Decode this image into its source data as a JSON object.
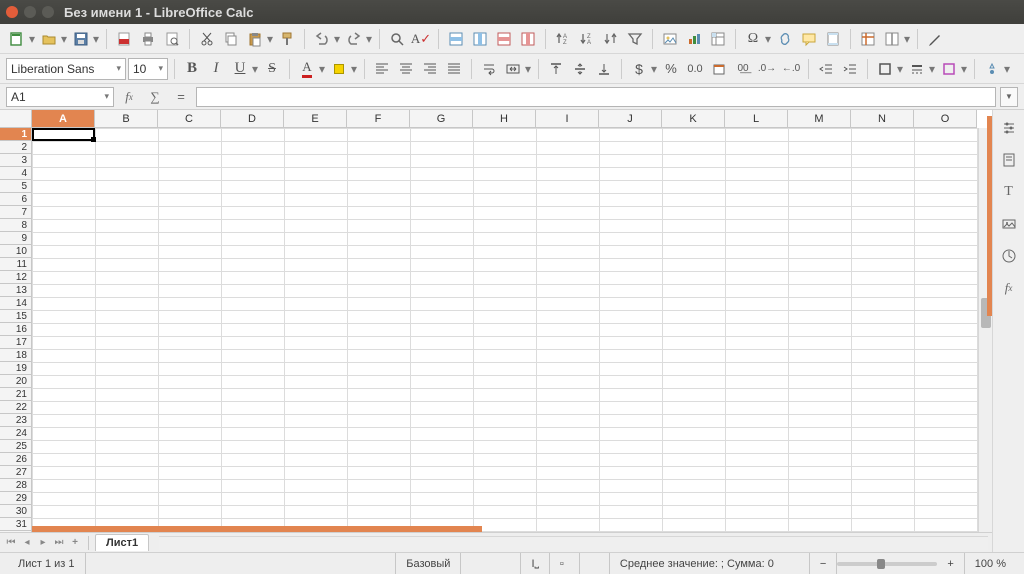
{
  "title": "Без имени 1 - LibreOffice Calc",
  "font": {
    "name": "Liberation Sans",
    "size": "10"
  },
  "namebox": "A1",
  "formula": "",
  "columns": [
    "A",
    "B",
    "C",
    "D",
    "E",
    "F",
    "G",
    "H",
    "I",
    "J",
    "K",
    "L",
    "M",
    "N",
    "O"
  ],
  "rows": [
    "1",
    "2",
    "3",
    "4",
    "5",
    "6",
    "7",
    "8",
    "9",
    "10",
    "11",
    "12",
    "13",
    "14",
    "15",
    "16",
    "17",
    "18",
    "19",
    "20",
    "21",
    "22",
    "23",
    "24",
    "25",
    "26",
    "27",
    "28",
    "29",
    "30",
    "31"
  ],
  "selected_col": "A",
  "selected_row": "1",
  "tabs": {
    "sheet1": "Лист1"
  },
  "status": {
    "sheet_pos": "Лист 1 из 1",
    "style": "Базовый",
    "summary": "Среднее значение: ; Сумма: 0",
    "zoom": "100 %"
  },
  "tooltips": {
    "new": "New",
    "open": "Open",
    "save": "Save",
    "pdf": "Export PDF",
    "print": "Print",
    "preview": "Print Preview",
    "cut": "Cut",
    "copy": "Copy",
    "paste": "Paste",
    "clone": "Clone Formatting",
    "undo": "Undo",
    "redo": "Redo",
    "find": "Find & Replace",
    "spell": "Spelling",
    "row": "Row",
    "column": "Column",
    "sort_asc": "Sort Ascending",
    "sort_desc": "Sort Descending",
    "autofilter": "AutoFilter",
    "chart": "Chart",
    "pivot": "Pivot Table",
    "image": "Image",
    "special": "Special Character",
    "hyperlink": "Hyperlink",
    "comment": "Comment",
    "headers": "Headers & Footers",
    "freeze": "Freeze",
    "split": "Split Window",
    "bold": "Bold",
    "italic": "Italic",
    "underline": "Underline",
    "strike": "Strikethrough",
    "fontcolor": "Font Color",
    "highlight": "Highlighting",
    "al": "Align Left",
    "ac": "Align Center",
    "ar": "Align Right",
    "aj": "Justified",
    "wrap": "Wrap Text",
    "merge": "Merge Cells",
    "at": "Align Top",
    "am": "Align Middle",
    "ab": "Align Bottom",
    "curr": "Currency",
    "pct": "Percent",
    "num": "Number",
    "date": "Date",
    "std": "Standard",
    "add_dec": "Add Decimal",
    "del_dec": "Delete Decimal",
    "ind_inc": "Increase Indent",
    "ind_dec": "Decrease Indent",
    "borders": "Borders",
    "border_style": "Border Style",
    "border_color": "Border Color",
    "cond": "Conditional"
  },
  "colors": {
    "accent": "#e28550",
    "font_color": "#cc2020",
    "highlight": "#f6d300",
    "border_color": "#b84bb8"
  }
}
